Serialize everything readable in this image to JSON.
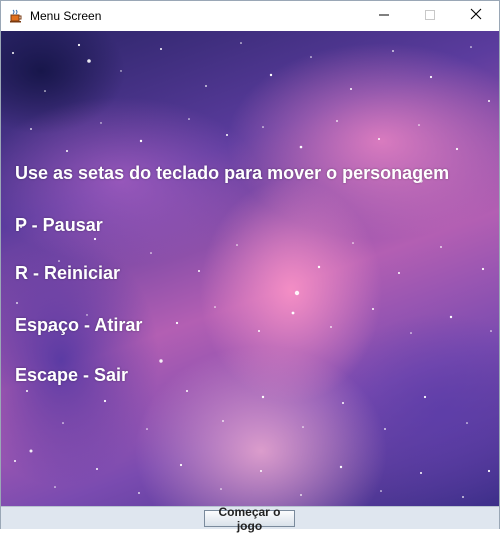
{
  "window": {
    "title": "Menu Screen",
    "app_icon": "java-cup-icon",
    "controls": [
      "minimize-icon",
      "maximize-icon",
      "close-icon"
    ]
  },
  "instructions": [
    "Use as setas do teclado para mover o personagem",
    "P - Pausar",
    "R - Reiniciar",
    "Espaço - Atirar",
    "Escape - Sair"
  ],
  "start_button": {
    "label": "Começar o jogo"
  },
  "colors": {
    "text": "#ffffff",
    "background_theme": "purple-pink galaxy",
    "button_bar": "#dfe6ef"
  }
}
